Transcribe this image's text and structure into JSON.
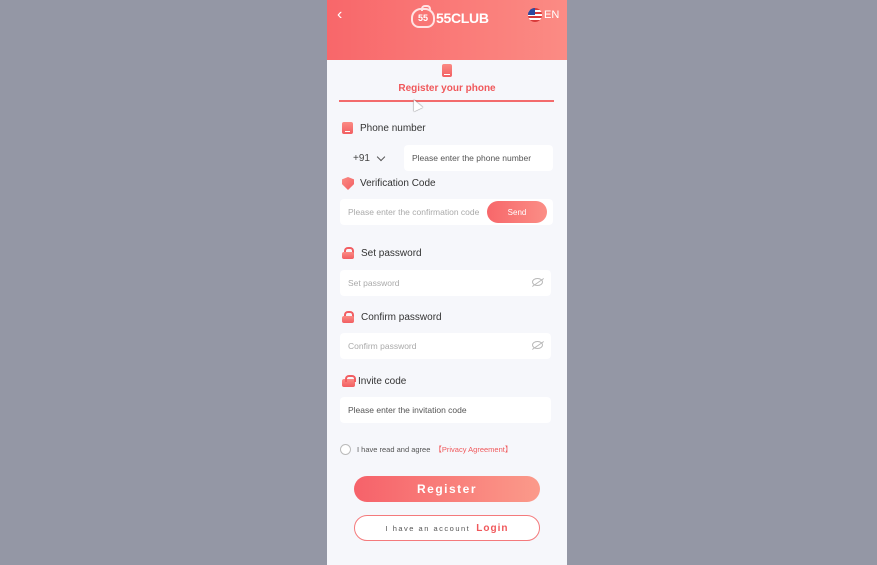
{
  "header": {
    "back_icon": "chevron-left-icon",
    "logo_mark": "55",
    "logo_text": "55CLUB",
    "language": "EN",
    "flag_icon": "us-flag-icon",
    "gradient_start": "#f8676a",
    "gradient_end": "#fb8b84"
  },
  "tab": {
    "icon": "phone-icon",
    "label": "Register your phone",
    "accent": "#f0585b"
  },
  "phone": {
    "label": "Phone number",
    "icon": "phone-icon",
    "country_code": "+91",
    "placeholder": "Please enter the phone number"
  },
  "verification": {
    "label": "Verification Code",
    "icon": "shield-icon",
    "placeholder": "Please enter the confirmation code",
    "send_label": "Send"
  },
  "password": {
    "label": "Set password",
    "icon": "lock-icon",
    "placeholder": "Set password"
  },
  "confirm_password": {
    "label": "Confirm password",
    "icon": "lock-icon",
    "placeholder": "Confirm password"
  },
  "invite": {
    "label": "Invite code",
    "icon": "gift-icon",
    "placeholder": "Please enter the invitation code"
  },
  "agreement": {
    "text": "I have read and agree",
    "link": "【Privacy Agreement】"
  },
  "actions": {
    "register_label": "Register",
    "account_text": "I have an account",
    "login_label": "Login"
  }
}
